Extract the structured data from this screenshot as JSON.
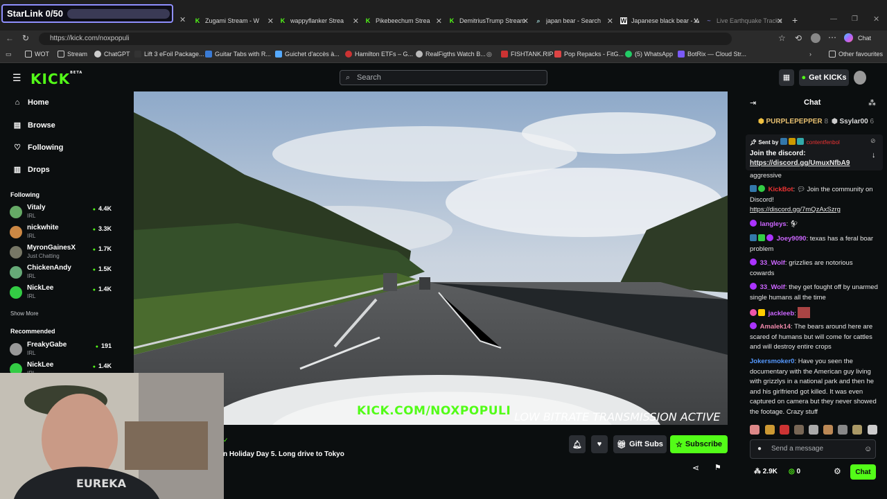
{
  "overlay": {
    "starlink_label": "StarLink 0/50"
  },
  "tabs": [
    {
      "label": "Zugami Stream - W"
    },
    {
      "label": "wappyflanker Strea"
    },
    {
      "label": "Pikebeechum Strea"
    },
    {
      "label": "DemitriusTrump Stream"
    },
    {
      "label": "japan bear - Search"
    },
    {
      "label": "Japanese black bear - W"
    },
    {
      "label": "Live Earthquake Tracke"
    }
  ],
  "address": {
    "url": "https://kick.com/noxpopuli"
  },
  "browser": {
    "chat_label": "Chat"
  },
  "bookmarks": [
    {
      "label": "WOT"
    },
    {
      "label": "Stream"
    },
    {
      "label": "ChatGPT"
    },
    {
      "label": "Lift 3 eFoil Package..."
    },
    {
      "label": "Guitar Tabs with R..."
    },
    {
      "label": "Guichet d'accès à..."
    },
    {
      "label": "Hamilton ETFs – G..."
    },
    {
      "label": "RealFigths Watch B..."
    },
    {
      "label": "FISHTANK.RIP"
    },
    {
      "label": "Pop Repacks - FitG..."
    },
    {
      "label": "(5) WhatsApp"
    },
    {
      "label": "BotRix — Cloud Str..."
    },
    {
      "label": "Other favourites"
    }
  ],
  "kick": {
    "logo": "KICK",
    "beta": "BETA",
    "search_placeholder": "Search",
    "get_kicks": "Get KICKs"
  },
  "nav": [
    {
      "label": "Home"
    },
    {
      "label": "Browse"
    },
    {
      "label": "Following"
    },
    {
      "label": "Drops"
    }
  ],
  "sidebar": {
    "following_title": "Following",
    "following": [
      {
        "name": "Vitaly",
        "category": "IRL",
        "viewers": "4.4K"
      },
      {
        "name": "nickwhite",
        "category": "IRL",
        "viewers": "3.3K"
      },
      {
        "name": "MyronGainesX",
        "category": "Just Chatting",
        "viewers": "1.7K"
      },
      {
        "name": "ChickenAndy",
        "category": "IRL",
        "viewers": "1.5K"
      },
      {
        "name": "NickLee",
        "category": "IRL",
        "viewers": "1.4K"
      }
    ],
    "show_more": "Show More",
    "recommended_title": "Recommended",
    "recommended": [
      {
        "name": "FreakyGabe",
        "category": "IRL",
        "viewers": "191"
      },
      {
        "name": "NickLee",
        "category": "IRL",
        "viewers": "1.4K"
      }
    ]
  },
  "player": {
    "overlay_channel": "KICK.COM/NOXPOPULI",
    "overlay_status": "LOW BITRATE TRANSMISSION ACTIVE"
  },
  "stream": {
    "title": "n Holiday Day 5. Long drive to Tokyo",
    "gift_subs": "Gift Subs",
    "subscribe": "Subscribe"
  },
  "chat": {
    "title": "Chat",
    "top_gifters": [
      {
        "name": "PURPLEPEPPER",
        "count": "8"
      },
      {
        "name": "Ssylar00",
        "count": "6"
      }
    ],
    "pinned": {
      "sent_by_label": "Sent by",
      "sender": "contentfenbol",
      "text": "Join the discord:",
      "link": "https://discord.gg/UmuxNfbA9"
    },
    "messages": [
      {
        "user": "",
        "text": "aggressive"
      },
      {
        "user": "KickBot",
        "text": "Join the community on Discord!",
        "link": "https://discord.gg/7mQzAxSzrg"
      },
      {
        "user": "langleys",
        "text": ""
      },
      {
        "user": "Joey9090",
        "text": "texas has a feral boar problem"
      },
      {
        "user": "33_Wolf",
        "text": "grizzlies are notorious cowards"
      },
      {
        "user": "33_Wolf",
        "text": "they get fought off by unarmed single humans all the time"
      },
      {
        "user": "jackleeb",
        "text": ""
      },
      {
        "user": "Amalek14",
        "text": "The bears around here are scared of humans but will come for cattles and will destroy entire crops"
      },
      {
        "user": "Jokersmoker0",
        "text": "Have you seen the documentary with the American guy living with grizzlys in a national park and then he and his girlfriend got killed. It was even captured on camera but they never showed the footage. Crazy stuff"
      }
    ],
    "send_placeholder": "Send a message",
    "viewers": "2.9K",
    "kicks": "0",
    "chat_button": "Chat"
  },
  "colors": {
    "kick_green": "#53fc18",
    "background": "#0b0e0f",
    "panel": "#17191c"
  }
}
